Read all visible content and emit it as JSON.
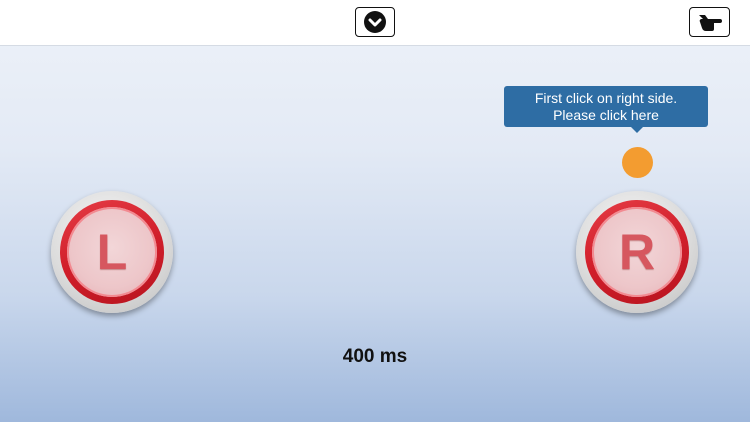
{
  "toolbar": {
    "center_icon": "chevron-down-circle-icon",
    "right_icon": "pointing-hand-icon"
  },
  "tooltip": {
    "line1": "First click on right side.",
    "line2": "Please click here",
    "color": "#2e6da4"
  },
  "target": {
    "color": "#f39c30"
  },
  "pads": {
    "left_label": "L",
    "right_label": "R",
    "ring_color": "#d11f2b"
  },
  "timer": {
    "text": "400 ms"
  }
}
